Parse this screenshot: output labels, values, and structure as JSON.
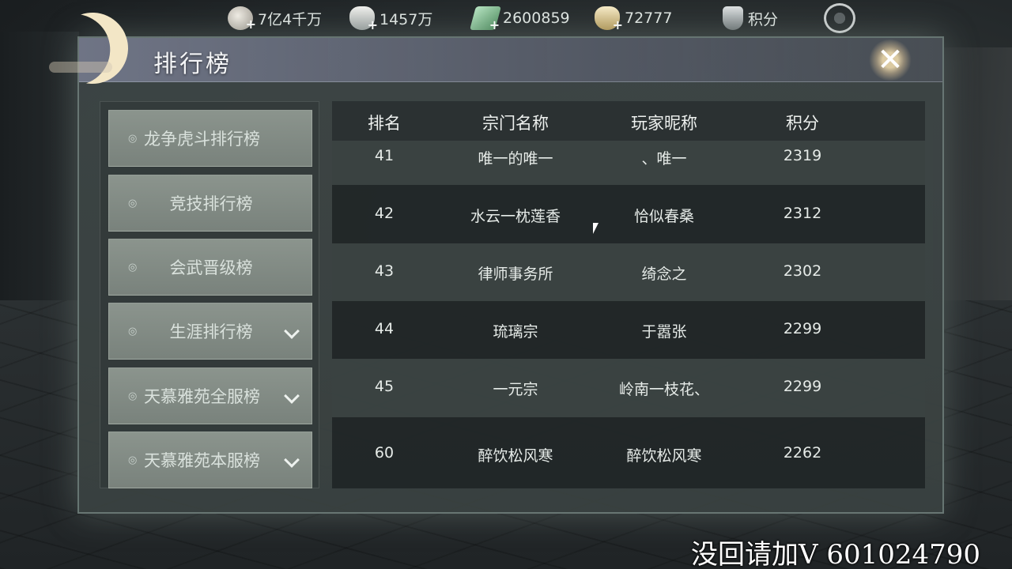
{
  "currencies": [
    {
      "icon": "silver-coin-icon",
      "value": "7亿4千万"
    },
    {
      "icon": "silver-ingot-icon",
      "value": "1457万"
    },
    {
      "icon": "jade-icon",
      "value": "2600859"
    },
    {
      "icon": "gold-ingot-icon",
      "value": "72777"
    },
    {
      "icon": "points-shield-icon",
      "value": "积分"
    }
  ],
  "panel": {
    "title": "排行榜",
    "close_icon": "✕"
  },
  "menu": [
    {
      "label": "龙争虎斗排行榜",
      "expandable": false
    },
    {
      "label": "竞技排行榜",
      "expandable": false
    },
    {
      "label": "会武晋级榜",
      "expandable": false
    },
    {
      "label": "生涯排行榜",
      "expandable": true
    },
    {
      "label": "天慕雅苑全服榜",
      "expandable": true
    },
    {
      "label": "天慕雅苑本服榜",
      "expandable": true
    }
  ],
  "table": {
    "headers": {
      "rank": "排名",
      "sect": "宗门名称",
      "player": "玩家昵称",
      "score": "积分"
    },
    "rows": [
      {
        "rank": "41",
        "sect": "唯一的唯一",
        "player": "、唯一",
        "score": "2319"
      },
      {
        "rank": "42",
        "sect": "水云一枕莲香",
        "player": "恰似春桑",
        "score": "2312"
      },
      {
        "rank": "43",
        "sect": "律师事务所",
        "player": "绮念之",
        "score": "2302"
      },
      {
        "rank": "44",
        "sect": "琉璃宗",
        "player": "于嚣张",
        "score": "2299"
      },
      {
        "rank": "45",
        "sect": "一元宗",
        "player": "岭南一枝花、",
        "score": "2299"
      },
      {
        "rank": "60",
        "sect": "醉饮松风寒",
        "player": "醉饮松风寒",
        "score": "2262"
      }
    ]
  },
  "watermark": "没回请加V   601024790",
  "colors": {
    "panel": "#3e4646",
    "menu_item": "#858e88",
    "table_header": "#2b3132"
  }
}
